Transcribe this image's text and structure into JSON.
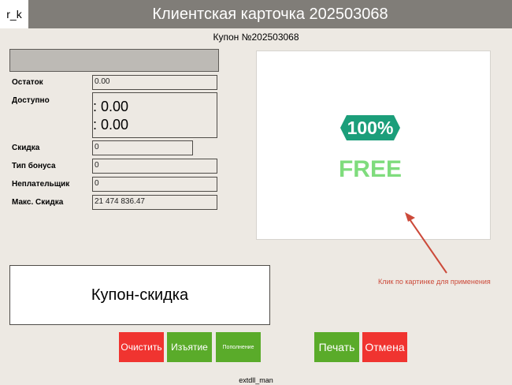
{
  "header": {
    "logo": "r_k",
    "title": "Клиентская карточка 202503068"
  },
  "coupon_number": "Купон №202503068",
  "fields": {
    "remainder_label": "Остаток",
    "remainder_value": "0.00",
    "available_label": "Доступно",
    "available_line1": ": 0.00",
    "available_line2": ": 0.00",
    "discount_label": "Скидка",
    "discount_value": "0",
    "bonus_type_label": "Тип бонуса",
    "bonus_type_value": "0",
    "nonpayer_label": "Неплательщик",
    "nonpayer_value": "0",
    "max_discount_label": "Макс. Скидка",
    "max_discount_value": "21 474 836.47"
  },
  "coupon_image": {
    "badge_text": "100%",
    "free_text": "FREE",
    "icon": "free-coupon-icon",
    "teal": "#1b9e7a",
    "green": "#7fdc7d"
  },
  "hint": "Клик по картинке для применения",
  "coupon_type": "Купон-скидка",
  "buttons": {
    "clear": "Очистить",
    "withdraw": "Изъятие",
    "topup": "Пополнение",
    "print": "Печать",
    "cancel": "Отмена"
  },
  "footer": "extdll_man"
}
